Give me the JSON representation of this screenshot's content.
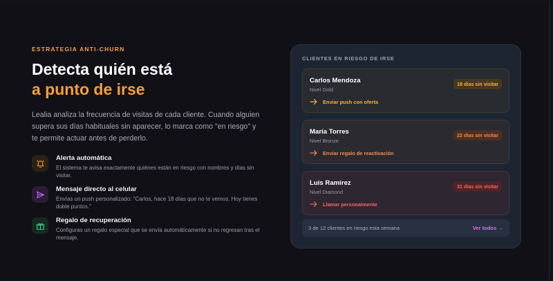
{
  "section": {
    "eyebrow": "ESTRATEGIA ANTI-CHURN",
    "headline_line1": "Detecta quién está",
    "headline_line2": "a punto de irse",
    "lead": "Lealia analiza la frecuencia de visitas de cada cliente. Cuando alguien supera sus días habituales sin aparecer, lo marca como \"en riesgo\" y te permite actuar antes de perderlo."
  },
  "features": [
    {
      "icon": "bell-icon",
      "title": "Alerta automática",
      "desc": "El sistema te avisa exactamente quiénes están en riesgo con nombres y días sin visitar."
    },
    {
      "icon": "send-icon",
      "title": "Mensaje directo al celular",
      "desc": "Envías un push personalizado: \"Carlos, hace 18 días que no te vemos. Hoy tienes doble puntos.\""
    },
    {
      "icon": "gift-icon",
      "title": "Regalo de recuperación",
      "desc": "Configuras un regalo especial que se envía automáticamente si no regresan tras el mensaje."
    }
  ],
  "panel": {
    "title": "CLIENTES EN RIESGO DE IRSE",
    "clients": [
      {
        "name": "Carlos Mendoza",
        "level": "Nivel Gold",
        "badge": "18 días sin visitar",
        "action": "Enviar push con oferta",
        "color": "#f1b33b"
      },
      {
        "name": "María Torres",
        "level": "Nivel Bronze",
        "badge": "22 días sin visitar",
        "action": "Enviar regalo de reactivación",
        "color": "#f08a4c"
      },
      {
        "name": "Luis Ramírez",
        "level": "Nivel Diamond",
        "badge": "31 días sin visitar",
        "action": "Llamar personalmente",
        "color": "#f06868"
      }
    ],
    "footer_text": "3 de 12 clientes en riesgo esta semana",
    "footer_link": "Ver todos →"
  },
  "colors": {
    "accent": "#f5a033",
    "link": "#e56bf0"
  }
}
